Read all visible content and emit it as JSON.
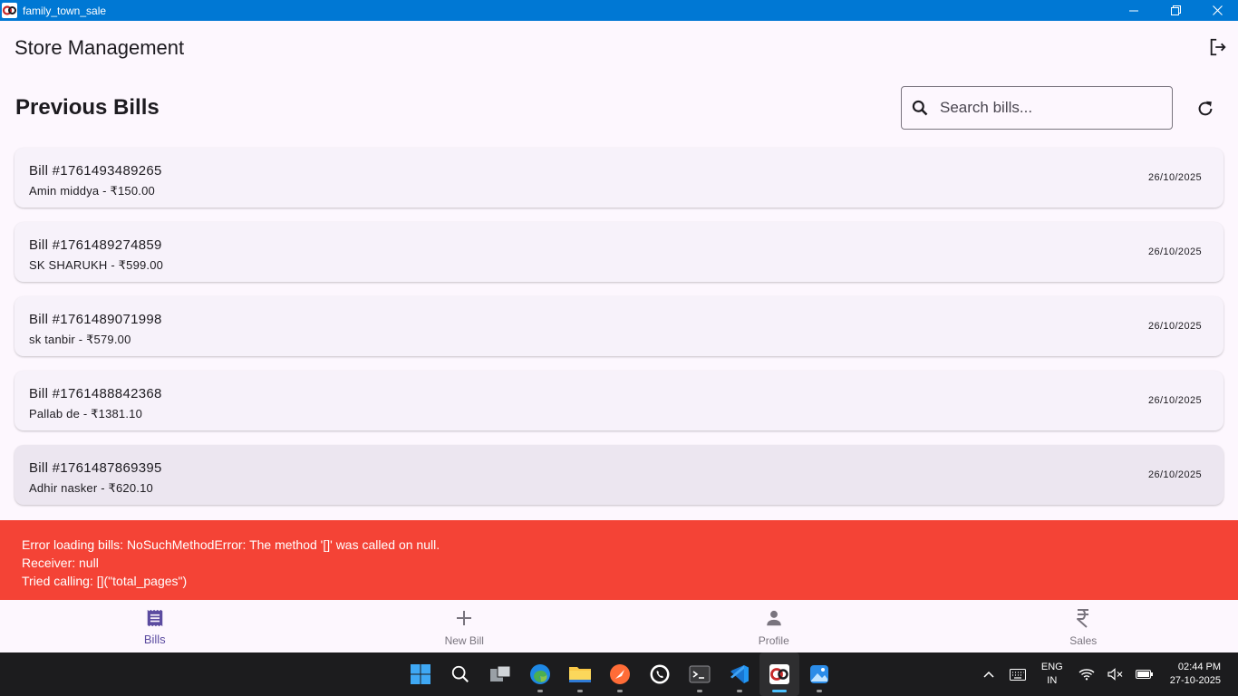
{
  "window": {
    "title": "family_town_sale"
  },
  "appbar": {
    "title": "Store Management"
  },
  "section": {
    "title": "Previous Bills"
  },
  "search": {
    "placeholder": "Search bills..."
  },
  "bills": [
    {
      "number": "Bill #1761493489265",
      "subtitle": "Amin middya - ₹150.00",
      "date": "26/10/2025"
    },
    {
      "number": "Bill #1761489274859",
      "subtitle": "SK SHARUKH - ₹599.00",
      "date": "26/10/2025"
    },
    {
      "number": "Bill #1761489071998",
      "subtitle": "sk tanbir - ₹579.00",
      "date": "26/10/2025"
    },
    {
      "number": "Bill #1761488842368",
      "subtitle": "Pallab de - ₹1381.10",
      "date": "26/10/2025"
    },
    {
      "number": "Bill #1761487869395",
      "subtitle": "Adhir nasker - ₹620.10",
      "date": "26/10/2025"
    }
  ],
  "error": {
    "line1": "Error loading bills: NoSuchMethodError: The method '[]' was called on null.",
    "line2": "Receiver: null",
    "line3": "Tried calling: [](\"total_pages\")"
  },
  "nav": [
    {
      "label": "Bills",
      "icon": "receipt-icon",
      "active": true
    },
    {
      "label": "New Bill",
      "icon": "plus-icon"
    },
    {
      "label": "Profile",
      "icon": "person-icon"
    },
    {
      "label": "Sales",
      "icon": "rupee-icon"
    }
  ],
  "taskbar": {
    "lang_top": "ENG",
    "lang_bottom": "IN",
    "time": "02:44 PM",
    "date": "27-10-2025"
  },
  "colors": {
    "titlebar": "#0078d4",
    "background": "#fdf7fe",
    "card": "#f7f2fa",
    "error": "#f44336",
    "nav_active": "#5b4ba0"
  }
}
